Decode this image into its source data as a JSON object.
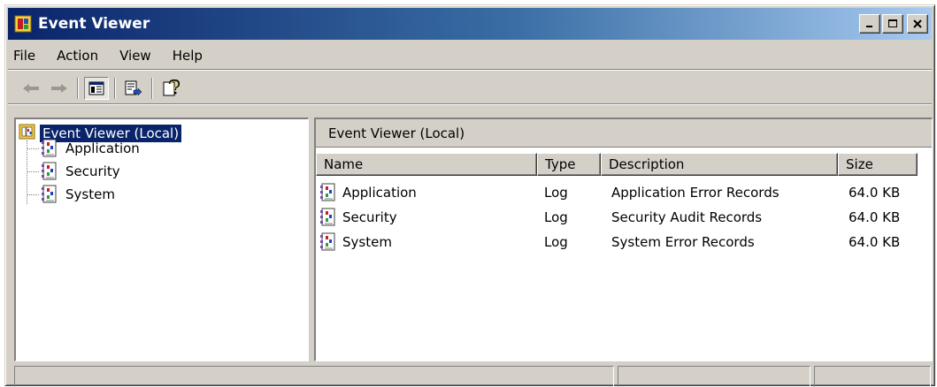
{
  "window": {
    "title": "Event Viewer",
    "app_icon": "event-viewer-icon",
    "caption_buttons": {
      "minimize": "_",
      "maximize": "□",
      "close": "×"
    }
  },
  "menu": [
    "File",
    "Action",
    "View",
    "Help"
  ],
  "toolbar": {
    "buttons": [
      {
        "name": "back-icon",
        "enabled": false
      },
      {
        "name": "forward-icon",
        "enabled": false
      },
      {
        "name": "show-hide-tree-icon",
        "enabled": true
      },
      {
        "name": "export-list-icon",
        "enabled": true
      },
      {
        "name": "help-icon",
        "enabled": true
      }
    ]
  },
  "tree": {
    "root": "Event Viewer (Local)",
    "children": [
      "Application",
      "Security",
      "System"
    ]
  },
  "right_pane": {
    "header": "Event Viewer (Local)",
    "columns": [
      "Name",
      "Type",
      "Description",
      "Size"
    ],
    "rows": [
      {
        "name": "Application",
        "type": "Log",
        "description": "Application Error Records",
        "size": "64.0 KB"
      },
      {
        "name": "Security",
        "type": "Log",
        "description": "Security Audit Records",
        "size": "64.0 KB"
      },
      {
        "name": "System",
        "type": "Log",
        "description": "System Error Records",
        "size": "64.0 KB"
      }
    ]
  },
  "colors": {
    "title_gradient_start": "#0a246a",
    "title_gradient_end": "#a6caf0",
    "face": "#d4d0c8",
    "selection": "#0a246a"
  }
}
